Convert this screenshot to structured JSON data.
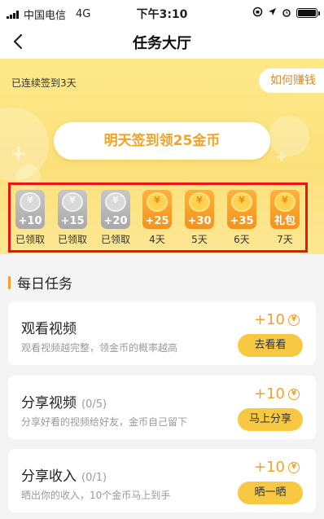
{
  "status_bar": {
    "carrier": "中国电信",
    "network": "4G",
    "time": "下午3:10"
  },
  "nav": {
    "title": "任务大厅",
    "back_icon": "chevron-left-icon"
  },
  "banner": {
    "streak_text": "已连续签到3天",
    "earn_label": "如何赚钱",
    "sign_label": "明天签到领25金币"
  },
  "checkin_days": [
    {
      "amount": "+10",
      "label": "已领取",
      "state": "claimed"
    },
    {
      "amount": "+15",
      "label": "已领取",
      "state": "claimed"
    },
    {
      "amount": "+20",
      "label": "已领取",
      "state": "claimed"
    },
    {
      "amount": "+25",
      "label": "4天",
      "state": "upcoming"
    },
    {
      "amount": "+30",
      "label": "5天",
      "state": "upcoming"
    },
    {
      "amount": "+35",
      "label": "6天",
      "state": "upcoming"
    },
    {
      "amount": "礼包",
      "label": "7天",
      "state": "upcoming"
    }
  ],
  "coin_symbol": "¥",
  "section": {
    "title": "每日任务"
  },
  "tasks": [
    {
      "title": "观看视频",
      "count": "",
      "desc": "观看视频越完整，领金币的概率越高",
      "reward": "+10",
      "button": "去看看"
    },
    {
      "title": "分享视频",
      "count": "(0/5)",
      "desc": "分享好看的视频给好友，金币自己留下",
      "reward": "+10",
      "button": "马上分享"
    },
    {
      "title": "分享收入",
      "count": "(0/1)",
      "desc": "晒出你的收入，10个金币马上到手",
      "reward": "+10",
      "button": "晒一晒"
    }
  ],
  "colors": {
    "accent": "#f0a326",
    "button": "#f7c943",
    "banner": "#fbe07a",
    "highlight_border": "#e8141a"
  }
}
